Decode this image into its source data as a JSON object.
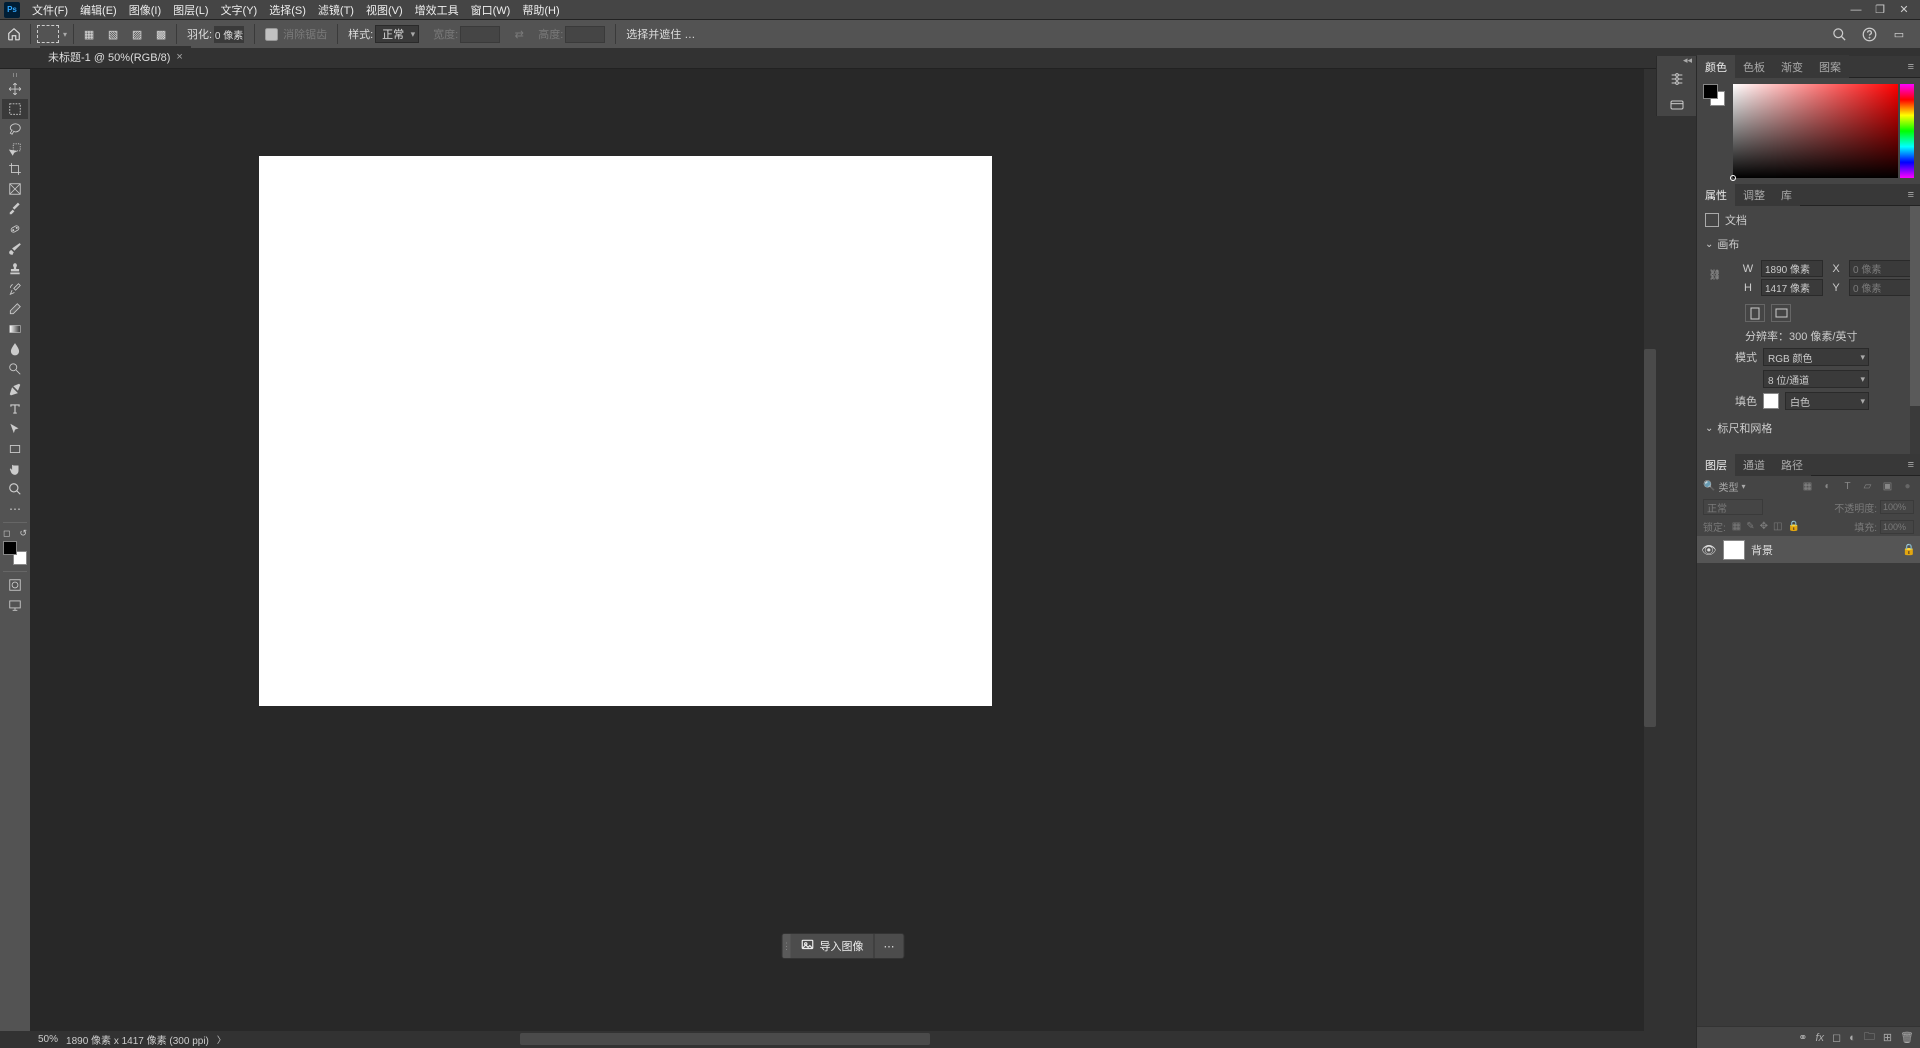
{
  "menu": {
    "items": [
      "文件(F)",
      "编辑(E)",
      "图像(I)",
      "图层(L)",
      "文字(Y)",
      "选择(S)",
      "滤镜(T)",
      "视图(V)",
      "增效工具",
      "窗口(W)",
      "帮助(H)"
    ]
  },
  "options": {
    "feather_label": "羽化:",
    "feather_value": "0 像素",
    "antialias": "消除锯齿",
    "style_label": "样式:",
    "style_value": "正常",
    "width_label": "宽度:",
    "height_label": "高度:",
    "select_mask": "选择并遮住 …"
  },
  "tab": {
    "title": "未标题-1 @ 50%(RGB/8)"
  },
  "import": {
    "label": "导入图像"
  },
  "status": {
    "zoom": "50%",
    "info": "1890 像素 x 1417 像素 (300 ppi)"
  },
  "color_tabs": [
    "颜色",
    "色板",
    "渐变",
    "图案"
  ],
  "props_tabs": [
    "属性",
    "调整",
    "库"
  ],
  "props": {
    "doc_label": "文档",
    "canvas_section": "画布",
    "W": "W",
    "H": "H",
    "X": "X",
    "Y": "Y",
    "w_val": "1890 像素",
    "h_val": "1417 像素",
    "xy_placeholder": "0 像素",
    "resolution": "分辨率：300 像素/英寸",
    "mode_label": "模式",
    "mode_value": "RGB 颜色",
    "depth_value": "8 位/通道",
    "fill_label": "填色",
    "fill_value": "白色",
    "ruler_section": "标尺和网格"
  },
  "layers_tabs": [
    "图层",
    "通道",
    "路径"
  ],
  "layers": {
    "kind": "类型",
    "blend": "正常",
    "opacity_label": "不透明度:",
    "opacity_val": "100%",
    "lock_label": "锁定:",
    "fill_label": "填充:",
    "fill_val": "100%",
    "layer_name": "背景"
  }
}
